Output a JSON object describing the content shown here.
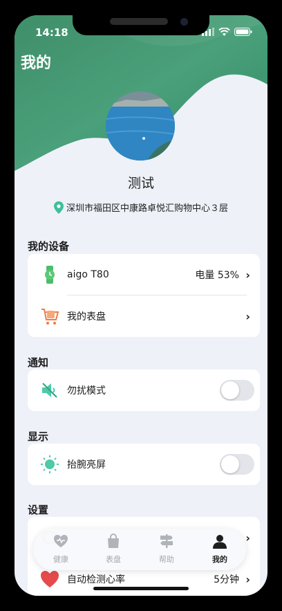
{
  "status_bar": {
    "time": "14:18"
  },
  "page_title": "我的",
  "profile": {
    "name": "测试",
    "location": "深圳市福田区中康路卓悦汇购物中心３层"
  },
  "sections": {
    "devices": {
      "title": "我的设备",
      "items": [
        {
          "label": "aigo T80",
          "value": "电量 53%",
          "icon": "watch-icon"
        },
        {
          "label": "我的表盘",
          "value": "",
          "icon": "watch-face-cart-icon"
        }
      ]
    },
    "notifications": {
      "title": "通知",
      "items": [
        {
          "label": "勿扰模式",
          "icon": "mute-icon",
          "toggle": false
        }
      ]
    },
    "display": {
      "title": "显示",
      "items": [
        {
          "label": "抬腕亮屏",
          "icon": "sun-icon",
          "toggle": false
        }
      ]
    },
    "settings": {
      "title": "设置",
      "items": [
        {
          "label": "",
          "value": "",
          "icon": "settings-item-icon"
        },
        {
          "label": "自动检测心率",
          "value": "5分钟",
          "icon": "heart-icon"
        }
      ]
    }
  },
  "tabbar": {
    "tabs": [
      {
        "label": "健康",
        "icon": "heart-tab-icon",
        "active": false
      },
      {
        "label": "表盘",
        "icon": "bag-tab-icon",
        "active": false
      },
      {
        "label": "帮助",
        "icon": "signpost-tab-icon",
        "active": false
      },
      {
        "label": "我的",
        "icon": "user-tab-icon",
        "active": true
      }
    ]
  },
  "colors": {
    "header_green": "#4a9e78",
    "accent_teal": "#3fbf9a",
    "background": "#eef1f8"
  }
}
